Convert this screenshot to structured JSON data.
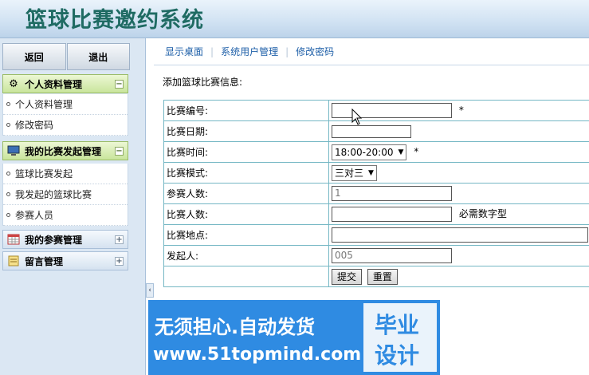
{
  "app": {
    "title": "篮球比赛邀约系统"
  },
  "sidebar": {
    "buttons": {
      "back": "返回",
      "logout": "退出"
    },
    "sections": [
      {
        "title": "个人资料管理",
        "icon": "gear-icon",
        "toggle": "−",
        "items": [
          "个人资料管理",
          "修改密码"
        ]
      },
      {
        "title": "我的比赛发起管理",
        "icon": "monitor-icon",
        "toggle": "−",
        "items": [
          "篮球比赛发起",
          "我发起的篮球比赛",
          "参赛人员"
        ]
      },
      {
        "title": "我的参赛管理",
        "icon": "calendar-icon",
        "toggle": "+"
      },
      {
        "title": "留言管理",
        "icon": "note-icon",
        "toggle": "+"
      }
    ],
    "collapse": "‹"
  },
  "tabs": [
    "显示桌面",
    "系统用户管理",
    "修改密码"
  ],
  "form": {
    "caption": "添加篮球比赛信息:",
    "labels": {
      "match_no": "比赛编号:",
      "match_date": "比赛日期:",
      "match_time": "比赛时间:",
      "match_mode": "比赛模式:",
      "participants": "参赛人数:",
      "players": "比赛人数:",
      "location": "比赛地点:",
      "initiator": "发起人:"
    },
    "values": {
      "match_no": "",
      "match_date": "",
      "match_time": "18:00-20:00",
      "match_mode": "三对三",
      "participants": "1",
      "players": "",
      "location": "",
      "initiator": "005"
    },
    "required_mark": "*",
    "players_hint": "必需数字型",
    "submit": "提交",
    "reset": "重置"
  },
  "banner": {
    "line1": "无须担心.自动发货",
    "line2": "www.51topmind.com",
    "box1": "毕业",
    "box2": "设计"
  }
}
